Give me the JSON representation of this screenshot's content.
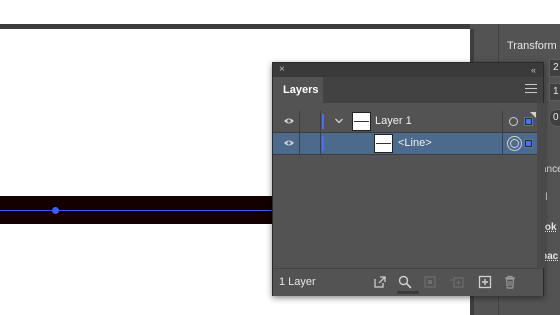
{
  "dock": {
    "title": "Transform",
    "fields": [
      "2",
      "1",
      "0"
    ],
    "partial_labels": [
      "ance",
      "ll",
      "rok",
      "pac"
    ]
  },
  "layers_panel": {
    "tab_label": "Layers",
    "close_glyph": "×",
    "collapse_glyph": "«",
    "rows": [
      {
        "label": "Layer 1",
        "expanded": true,
        "selected": false
      },
      {
        "label": "<Line>",
        "selected": true
      }
    ],
    "footer_count": "1 Layer",
    "footer_buttons": [
      "collect-for-export-icon",
      "locate-object-icon",
      "make-clipping-mask-icon",
      "create-sublayer-icon",
      "create-new-layer-icon",
      "trash-icon"
    ]
  },
  "colors": {
    "layer_color": "#4d6cff",
    "selected_row": "#4b6a8c",
    "panel_bg": "#535353"
  }
}
